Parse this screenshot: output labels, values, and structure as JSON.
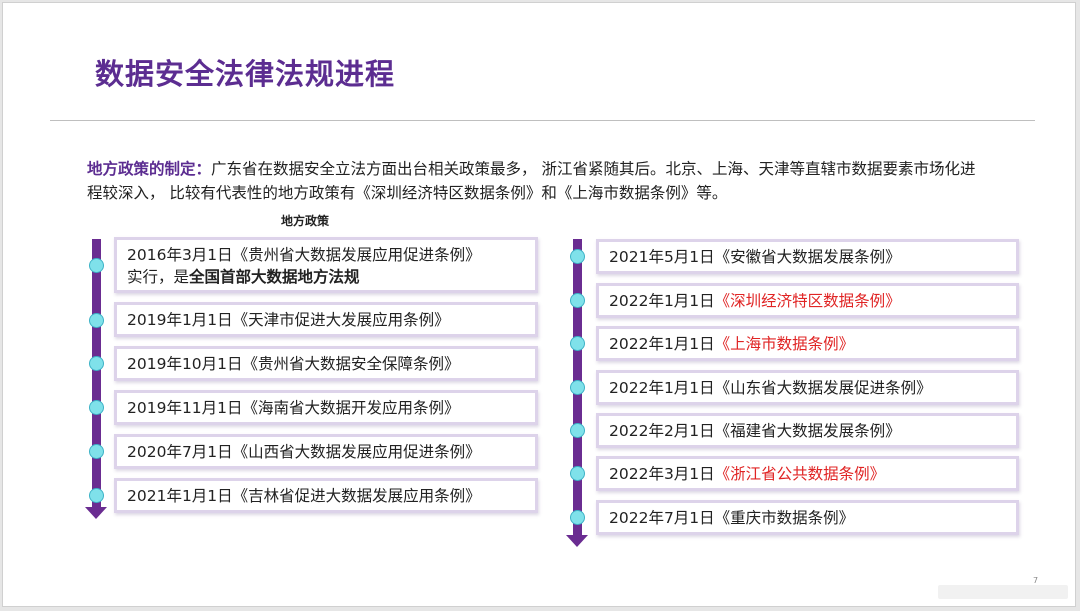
{
  "title": "数据安全法律法规进程",
  "intro": {
    "lead": "地方政策的制定：",
    "body": "广东省在数据安全立法方面出台相关政策最多， 浙江省紧随其后。北京、上海、天津等直辖市数据要素市场化进程较深入， 比较有代表性的地方政策有《深圳经济特区数据条例》和《上海市数据条例》等。"
  },
  "subhead": "地方政策",
  "left_items": [
    {
      "line1": "2016年3月1日《贵州省大数据发展应用促进条例》",
      "line2_plain": "实行，是",
      "line2_bold": "全国首部大数据地方法规"
    },
    {
      "date": "2019年1月1日",
      "name": "《天津市促进大发展应用条例》"
    },
    {
      "date": "2019年10月1日",
      "name": "《贵州省大数据安全保障条例》"
    },
    {
      "date": "2019年11月1日",
      "name": "《海南省大数据开发应用条例》"
    },
    {
      "date": "2020年7月1日",
      "name": "《山西省大数据发展应用促进条例》"
    },
    {
      "date": "2021年1月1日",
      "name": "《吉林省促进大数据发展应用条例》"
    }
  ],
  "right_items": [
    {
      "date": "2021年5月1日",
      "name": "《安徽省大数据发展条例》",
      "highlight": false
    },
    {
      "date": "2022年1月1日",
      "name": "《深圳经济特区数据条例》",
      "highlight": true
    },
    {
      "date": "2022年1月1日",
      "name": "《上海市数据条例》",
      "highlight": true
    },
    {
      "date": "2022年1月1日",
      "name": "《山东省大数据发展促进条例》",
      "highlight": false
    },
    {
      "date": "2022年2月1日",
      "name": "《福建省大数据发展条例》",
      "highlight": false
    },
    {
      "date": "2022年3月1日",
      "name": "《浙江省公共数据条例》",
      "highlight": true
    },
    {
      "date": "2022年7月1日",
      "name": "《重庆市数据条例》",
      "highlight": false
    }
  ],
  "page_number": "7",
  "colors": {
    "accent": "#5c2d91",
    "timeline": "#6a2c91",
    "dot": "#7fe1ea",
    "highlight": "#e02424"
  }
}
